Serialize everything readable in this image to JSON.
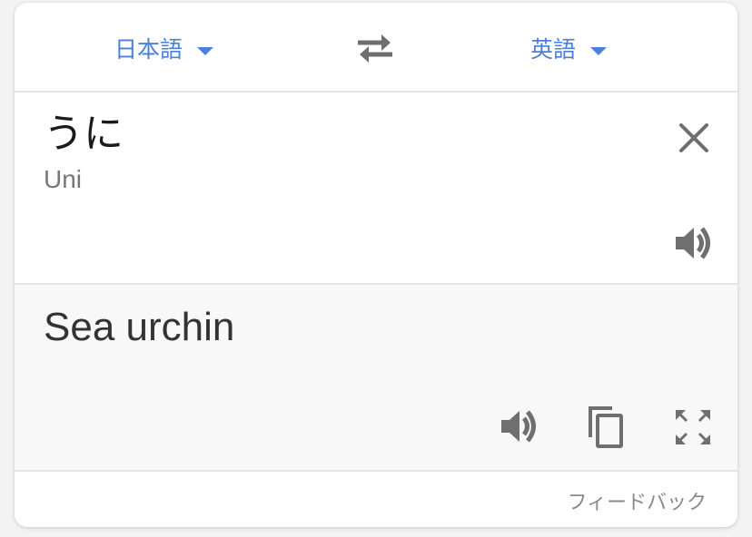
{
  "languages": {
    "source_label": "日本語",
    "target_label": "英語"
  },
  "source": {
    "text": "うに",
    "romanization": "Uni"
  },
  "result": {
    "text": "Sea urchin"
  },
  "footer": {
    "feedback_label": "フィードバック"
  },
  "colors": {
    "accent": "#4a7fdc",
    "icon": "#6f6f6f",
    "result_bg": "#f8f8f8",
    "divider": "#e4e4e4"
  },
  "icons": {
    "swap": "swap-arrows-icon",
    "clear": "close-icon",
    "source_speak": "speaker-icon",
    "result_speak": "speaker-icon",
    "copy": "copy-icon",
    "fullscreen": "fullscreen-icon"
  }
}
